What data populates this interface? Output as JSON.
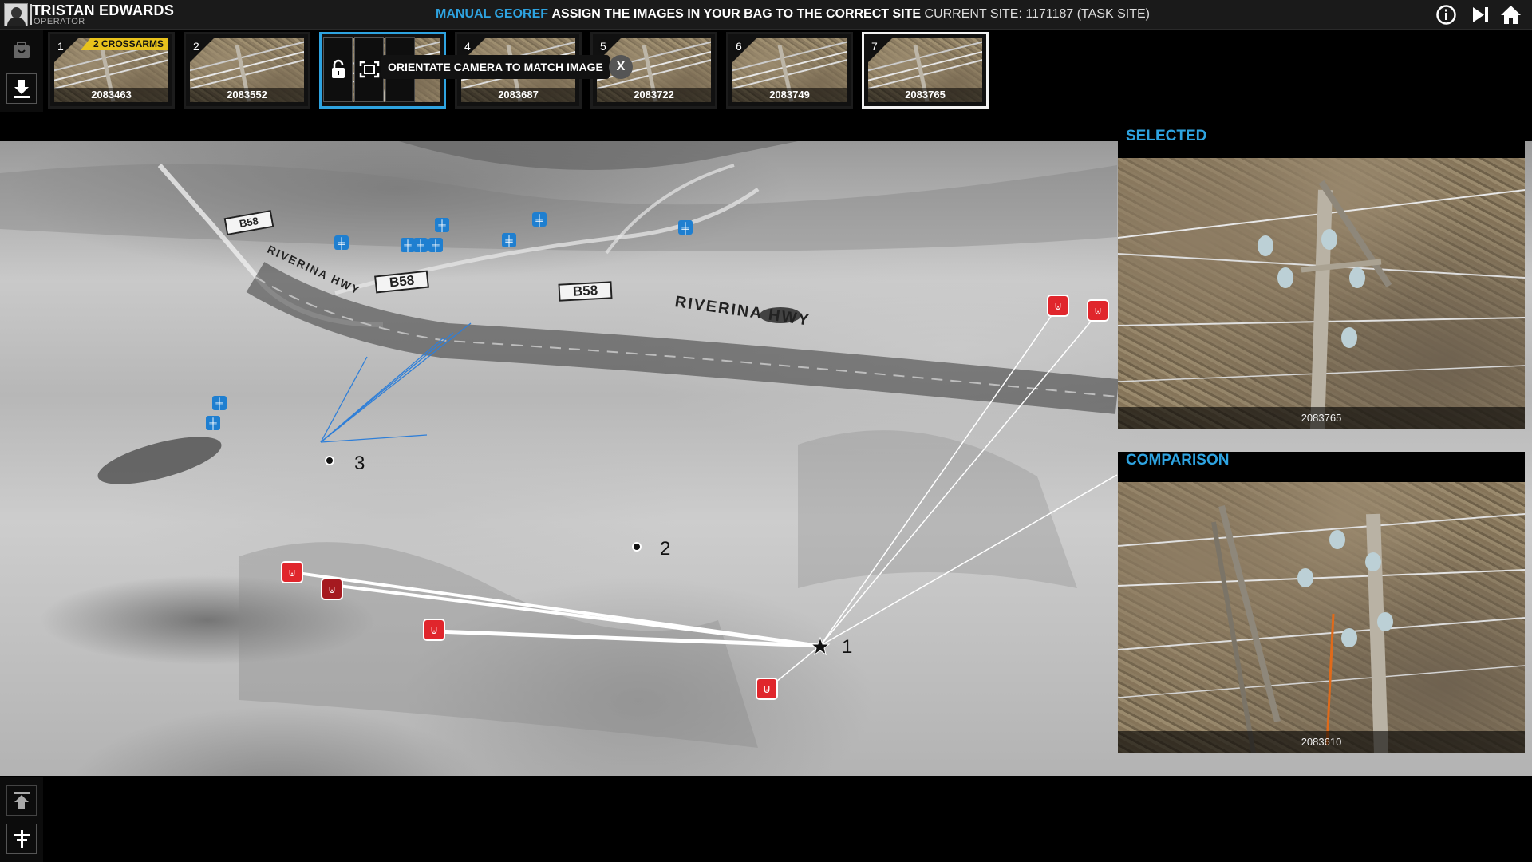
{
  "user": {
    "name": "TRISTAN EDWARDS",
    "role": "OPERATOR"
  },
  "header": {
    "mode": "MANUAL GEOREF",
    "instruction": "ASSIGN THE IMAGES IN YOUR BAG TO THE CORRECT SITE",
    "current_site": "CURRENT SITE: 1171187 (TASK SITE)",
    "icons": [
      "info-icon",
      "skip-forward-icon",
      "home-icon"
    ]
  },
  "toolbar_left": {
    "icons": [
      "bag-icon",
      "download-icon"
    ]
  },
  "thumbnails": [
    {
      "num": "1",
      "id": "2083463",
      "tag": "2 CROSSARMS"
    },
    {
      "num": "2",
      "id": "2083552",
      "tag": ""
    },
    {
      "num": "3",
      "id": "",
      "tag": ""
    },
    {
      "num": "4",
      "id": "2083687",
      "tag": ""
    },
    {
      "num": "5",
      "id": "2083722",
      "tag": ""
    },
    {
      "num": "6",
      "id": "2083749",
      "tag": ""
    },
    {
      "num": "7",
      "id": "2083765",
      "tag": ""
    }
  ],
  "orient": {
    "tooltip": "ORIENTATE CAMERA TO MATCH IMAGE",
    "close": "X",
    "icons": [
      "unlock-icon",
      "frame-icon"
    ]
  },
  "map": {
    "sites": [
      {
        "label": "1"
      },
      {
        "label": "2"
      },
      {
        "label": "3"
      }
    ],
    "road_signs": [
      "B58",
      "B58",
      "B58"
    ],
    "road_names": [
      "RIVERINA HWY",
      "RIVERINA HWY"
    ]
  },
  "panels": {
    "selected": {
      "title": "SELECTED",
      "caption": "2083765"
    },
    "comparison": {
      "title": "COMPARISON",
      "caption": "2083610"
    }
  },
  "bottom_left": {
    "icons": [
      "upload-icon",
      "pole-icon"
    ]
  },
  "colors": {
    "accent": "#2ea3e0",
    "bag_marker": "#e0262c",
    "pole_marker": "#1f7fd0",
    "tag": "#e8c21c"
  }
}
